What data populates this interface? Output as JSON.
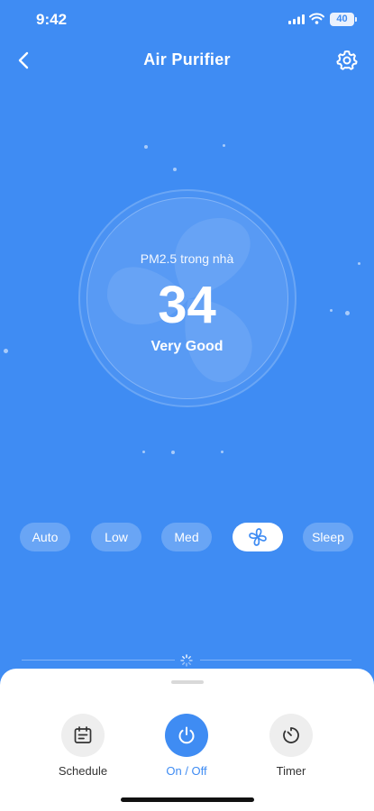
{
  "status_bar": {
    "time": "9:42",
    "battery": "40"
  },
  "header": {
    "title": "Air Purifier",
    "back_icon": "chevron-left-icon",
    "settings_icon": "gear-icon"
  },
  "air_quality": {
    "label": "PM2.5 trong nhà",
    "value": "34",
    "status": "Very Good"
  },
  "modes": {
    "items": [
      {
        "label": "Auto",
        "active": false
      },
      {
        "label": "Low",
        "active": false
      },
      {
        "label": "Med",
        "active": false
      },
      {
        "label": "",
        "icon": "fan-icon",
        "active": true
      },
      {
        "label": "Sleep",
        "active": false
      }
    ]
  },
  "actions": {
    "schedule": {
      "label": "Schedule",
      "icon": "calendar-icon"
    },
    "power": {
      "label": "On / Off",
      "icon": "power-icon"
    },
    "timer": {
      "label": "Timer",
      "icon": "timer-icon"
    }
  },
  "colors": {
    "primary": "#3f8cf3",
    "sheet": "#ffffff",
    "text_dark": "#333333"
  }
}
